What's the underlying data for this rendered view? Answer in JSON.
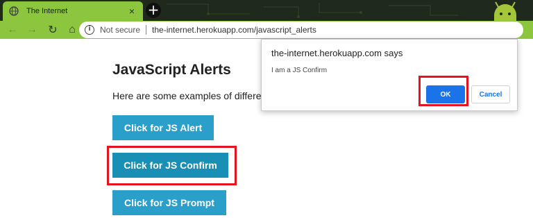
{
  "browser": {
    "tab_title": "The Internet",
    "tab_close": "×",
    "new_tab": "+",
    "back_glyph": "←",
    "forward_glyph": "→",
    "reload_glyph": "↻",
    "home_glyph": "⌂",
    "not_secure": "Not secure",
    "url": "the-internet.herokuapp.com/javascript_alerts",
    "info_glyph": "i",
    "icons": [
      "globe-icon",
      "android-icon",
      "info-icon",
      "back-arrow-icon",
      "forward-arrow-icon",
      "reload-icon",
      "home-icon"
    ]
  },
  "page": {
    "heading": "JavaScript Alerts",
    "description": "Here are some examples of different",
    "buttons": {
      "alert": "Click for JS Alert",
      "confirm": "Click for JS Confirm",
      "prompt": "Click for JS Prompt"
    }
  },
  "dialog": {
    "title": "the-internet.herokuapp.com says",
    "message": "I am a JS Confirm",
    "ok": "OK",
    "cancel": "Cancel"
  },
  "colors": {
    "chrome_green": "#8cc63f",
    "button_blue": "#2a9fc9",
    "highlight_red": "#e5131d",
    "dialog_ok_blue": "#1a73e8"
  }
}
